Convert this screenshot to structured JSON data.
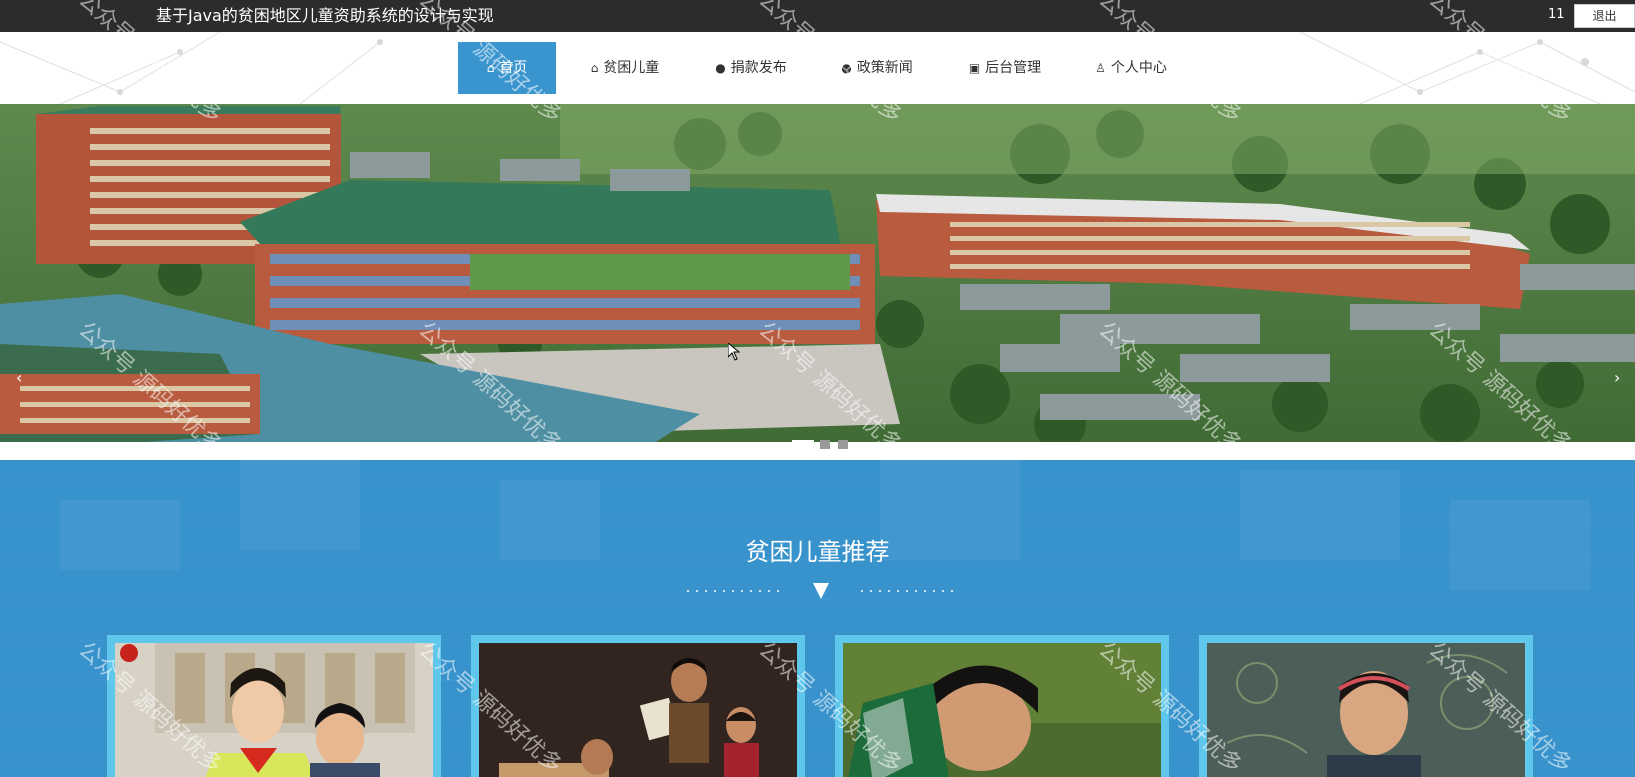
{
  "header": {
    "site_title": "基于Java的贫困地区儿童资助系统的设计与实现",
    "user_count": "11",
    "logout_label": "退出"
  },
  "nav": {
    "items": [
      {
        "label": "首页",
        "icon": "home-icon",
        "active": true
      },
      {
        "label": "贫困儿童",
        "icon": "bag-icon",
        "active": false
      },
      {
        "label": "捐款发布",
        "icon": "info-circle-icon",
        "active": false
      },
      {
        "label": "政策新闻",
        "icon": "question-circle-icon",
        "active": false
      },
      {
        "label": "后台管理",
        "icon": "briefcase-icon",
        "active": false
      },
      {
        "label": "个人中心",
        "icon": "user-icon",
        "active": false
      }
    ]
  },
  "banner": {
    "prev_label": "‹",
    "next_label": "›",
    "slide_count": 3,
    "active_slide": 1
  },
  "section": {
    "title": "贫困儿童推荐",
    "divider_icon": "triangle-down-icon"
  },
  "cards": [
    {
      "name": "child-card-1"
    },
    {
      "name": "child-card-2"
    },
    {
      "name": "child-card-3"
    },
    {
      "name": "child-card-4"
    }
  ],
  "watermark": {
    "text": "公众号 源码好优多"
  },
  "colors": {
    "topbar": "#2c2c2c",
    "nav_active": "#3a95cf",
    "section_bg": "#3893cc",
    "card_border": "#5fc6ec"
  }
}
